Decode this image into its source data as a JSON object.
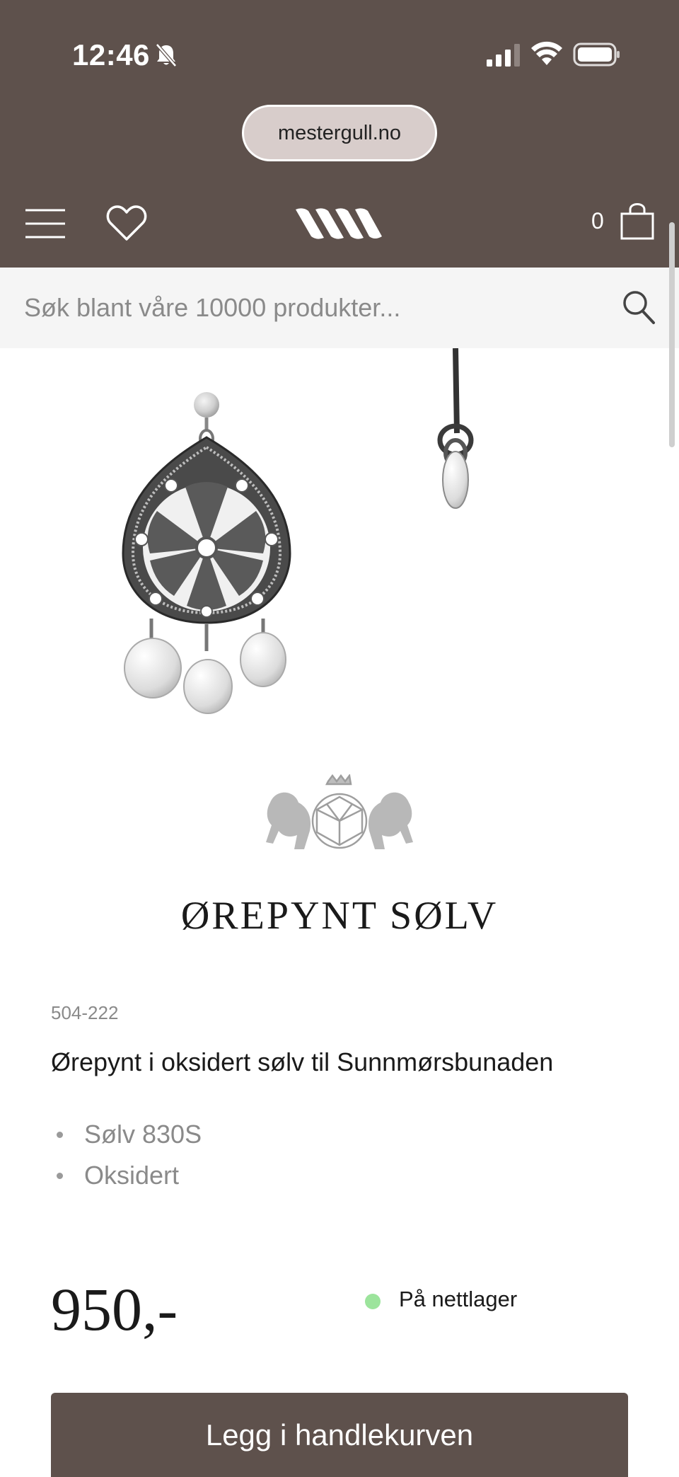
{
  "status_bar": {
    "time": "12:46",
    "icons": [
      "bell-slash-icon",
      "signal-icon",
      "wifi-icon",
      "battery-icon"
    ]
  },
  "browser": {
    "url": "mestergull.no"
  },
  "header": {
    "icons": [
      "menu-icon",
      "heart-icon",
      "mestergull-logo",
      "shopping-bag-icon"
    ],
    "cart_count": "0",
    "background": "#5e514c"
  },
  "search": {
    "placeholder": "Søk blant våre 10000 produkter...",
    "value": ""
  },
  "product": {
    "brand": "ØREPYNT SØLV",
    "sku": "504-222",
    "title": "Ørepynt i oksidert sølv til Sunnmørsbunaden",
    "specs": [
      "Sølv 830S",
      "Oksidert"
    ],
    "price": "950,-",
    "stock_label": "På nettlager",
    "stock_color": "#9ce49c"
  },
  "cta": {
    "add_to_cart_label": "Legg i handlekurven"
  }
}
